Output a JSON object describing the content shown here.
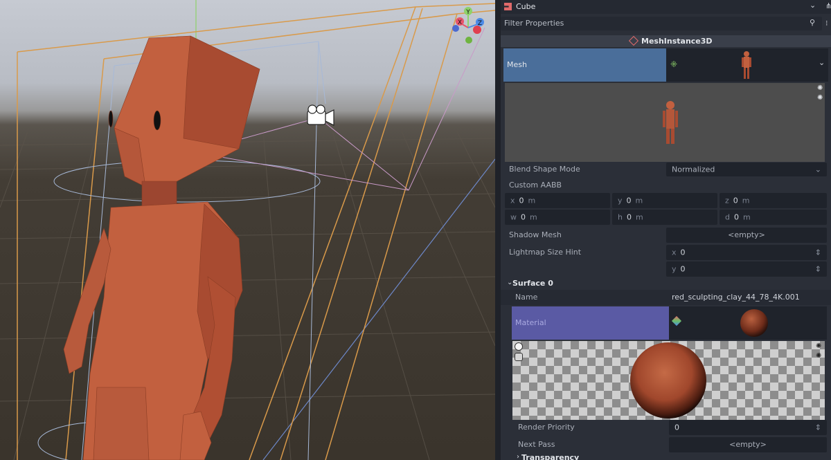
{
  "inspector": {
    "node_name": "Cube",
    "filter_placeholder": "Filter Properties",
    "class_name": "MeshInstance3D",
    "mesh_label": "Mesh",
    "blend_shape_mode_label": "Blend Shape Mode",
    "blend_shape_mode_value": "Normalized",
    "custom_aabb_label": "Custom AABB",
    "aabb": {
      "x_axis": "x",
      "x_value": "0",
      "x_unit": "m",
      "y_axis": "y",
      "y_value": "0",
      "y_unit": "m",
      "z_axis": "z",
      "z_value": "0",
      "z_unit": "m",
      "w_axis": "w",
      "w_value": "0",
      "w_unit": "m",
      "h_axis": "h",
      "h_value": "0",
      "h_unit": "m",
      "d_axis": "d",
      "d_value": "0",
      "d_unit": "m"
    },
    "shadow_mesh_label": "Shadow Mesh",
    "shadow_mesh_value": "<empty>",
    "lightmap_label": "Lightmap Size Hint",
    "lightmap_x_axis": "x",
    "lightmap_x_value": "0",
    "lightmap_y_axis": "y",
    "lightmap_y_value": "0",
    "surface_label": "Surface 0",
    "surface_name_label": "Name",
    "surface_name_value": "red_sculpting_clay_44_78_4K.001",
    "material_label": "Material",
    "render_priority_label": "Render Priority",
    "render_priority_value": "0",
    "next_pass_label": "Next Pass",
    "next_pass_value": "<empty>",
    "transparency_label": "Transparency"
  },
  "gizmo": {
    "x": "X",
    "y": "Y",
    "z": "Z"
  },
  "colors": {
    "mesh_highlight": "#4a6e9a",
    "material_highlight": "#5a5aa4",
    "clay": "#c2603f",
    "panel_bg": "#2b2f38",
    "field_bg": "#1f232b"
  }
}
